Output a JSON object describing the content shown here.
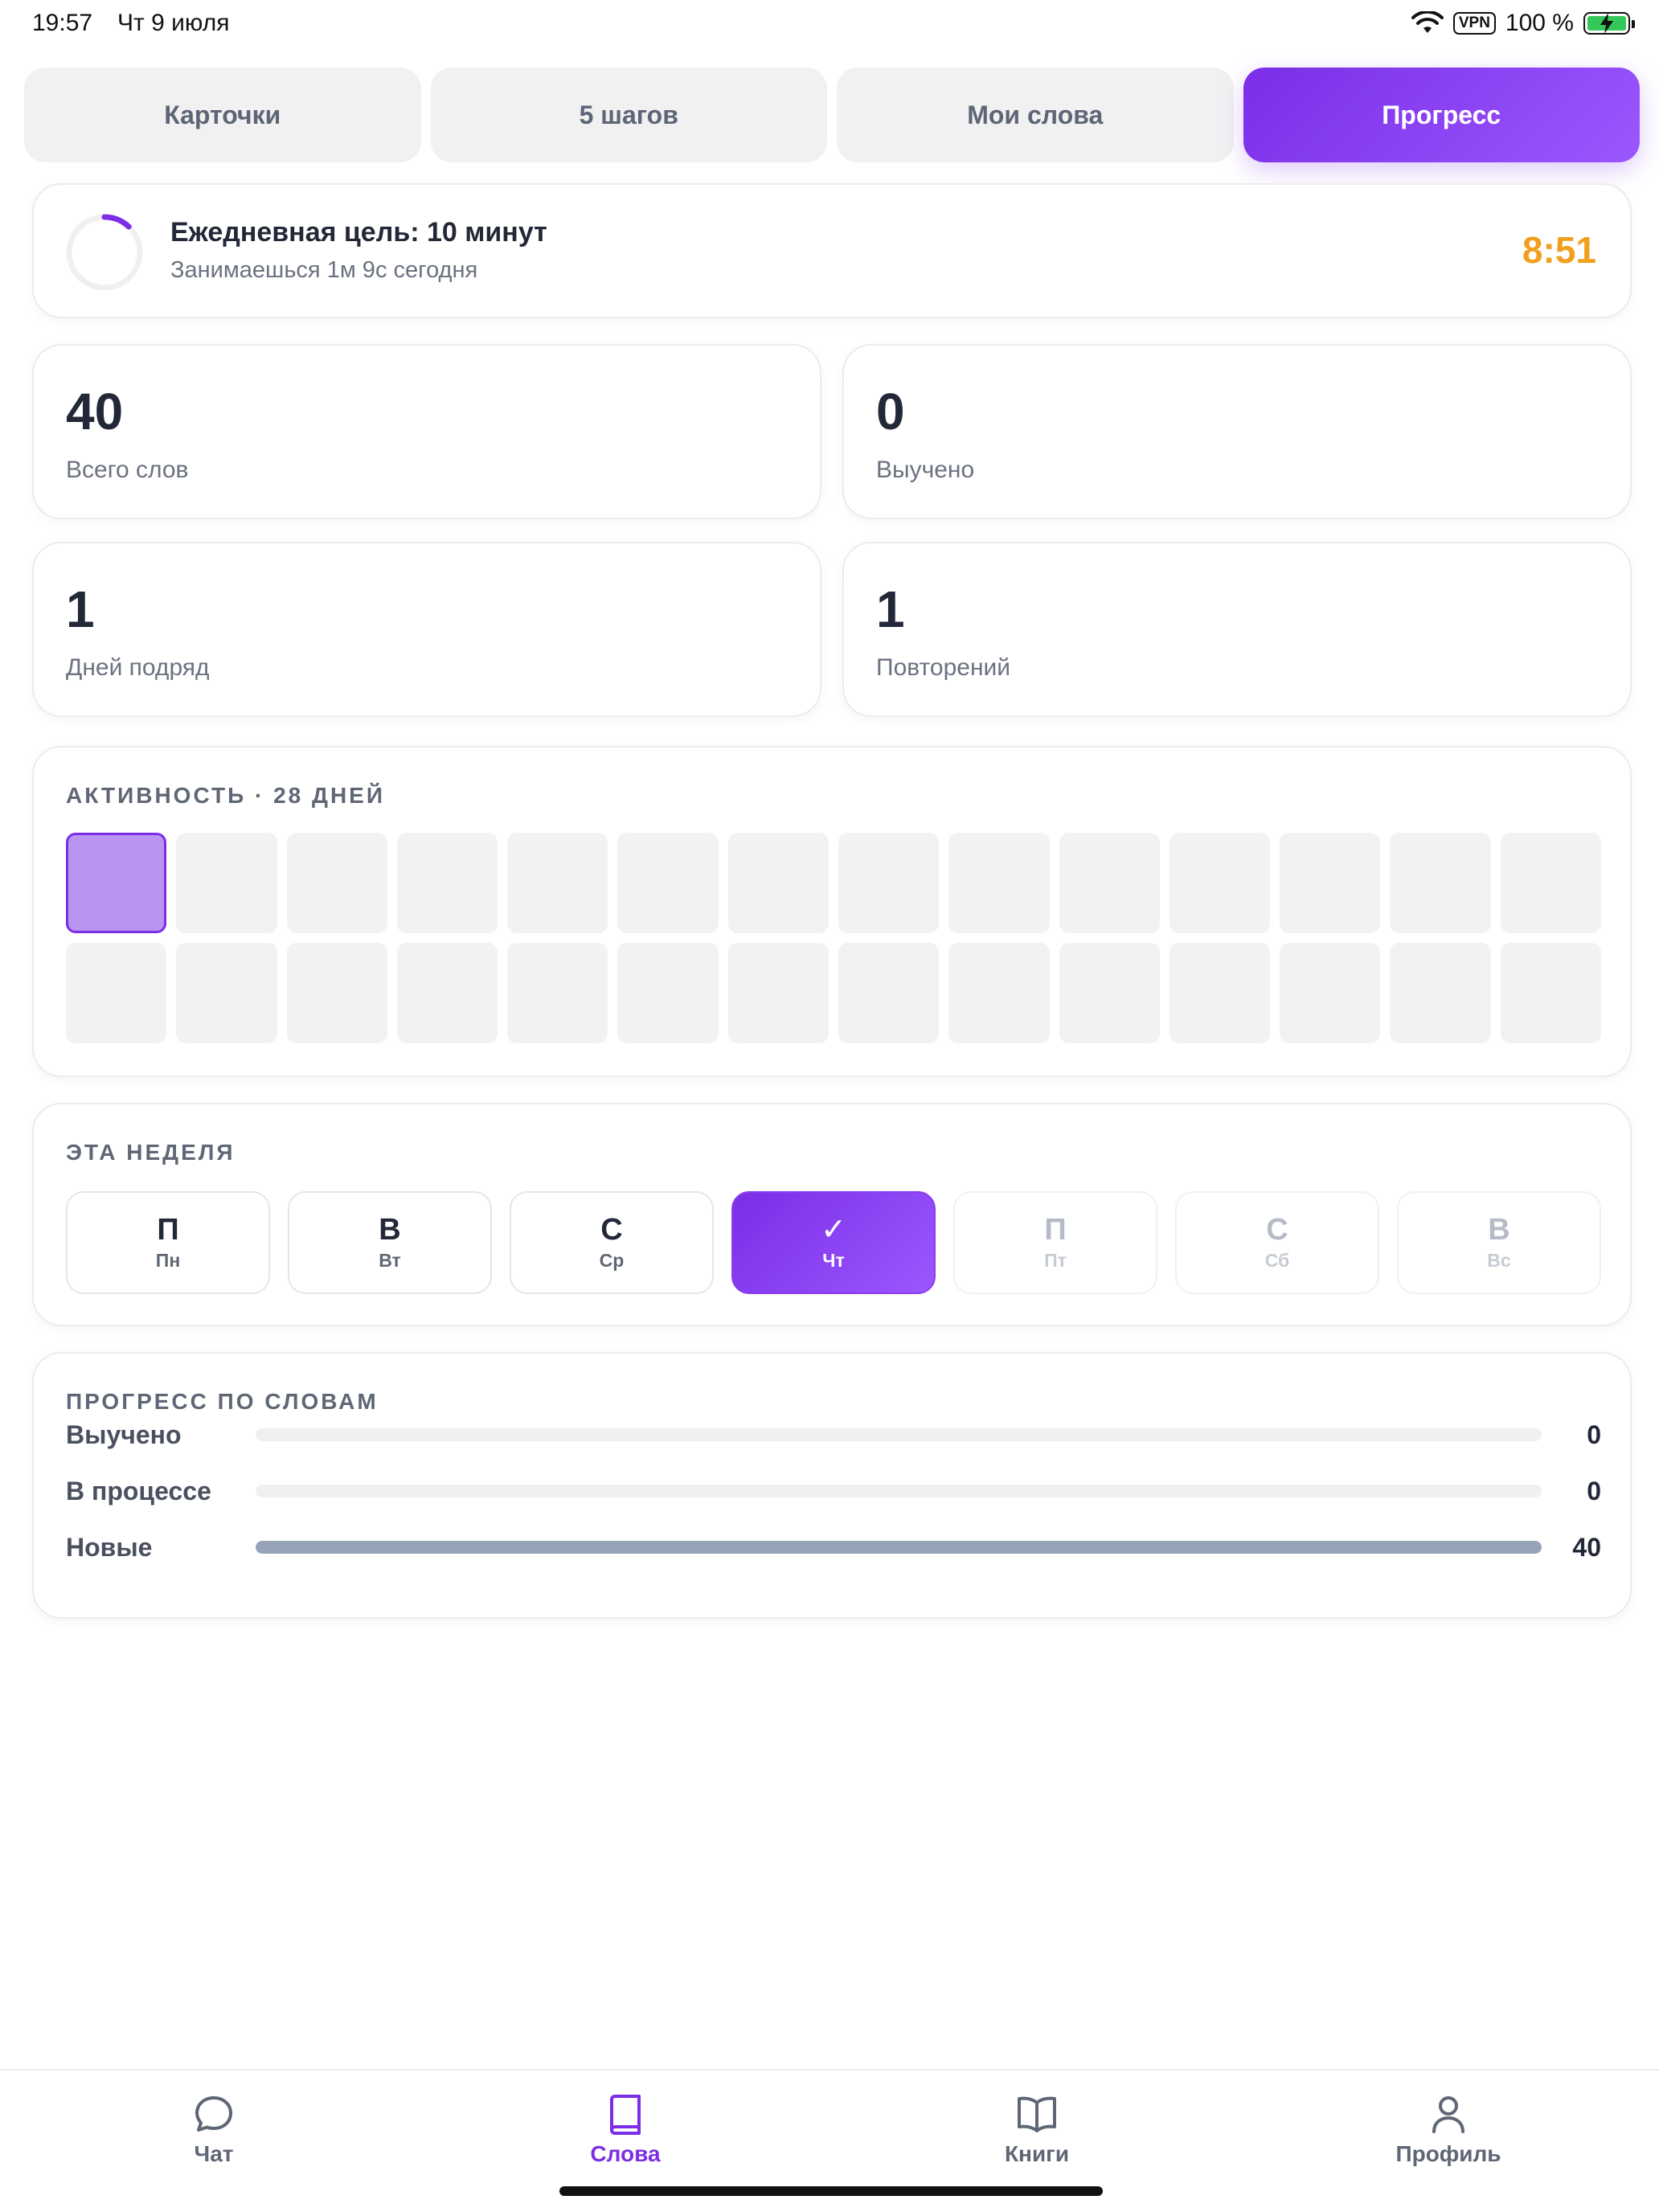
{
  "status_bar": {
    "time": "19:57",
    "date": "Чт 9 июля",
    "vpn": "VPN",
    "battery": "100 %"
  },
  "tabs": [
    {
      "label": "Карточки",
      "active": false
    },
    {
      "label": "5 шагов",
      "active": false
    },
    {
      "label": "Мои слова",
      "active": false
    },
    {
      "label": "Прогресс",
      "active": true
    }
  ],
  "goal": {
    "title": "Ежедневная цель: 10 минут",
    "subtitle": "Занимаешься 1м 9с сегодня",
    "remaining": "8:51",
    "progress_fraction": 0.12
  },
  "stats": [
    {
      "value": "40",
      "label": "Всего слов"
    },
    {
      "value": "0",
      "label": "Выучено"
    },
    {
      "value": "1",
      "label": "Дней подряд"
    },
    {
      "value": "1",
      "label": "Повторений"
    }
  ],
  "activity": {
    "title": "АКТИВНОСТЬ · 28 ДНЕЙ",
    "days": [
      1,
      0,
      0,
      0,
      0,
      0,
      0,
      0,
      0,
      0,
      0,
      0,
      0,
      0,
      0,
      0,
      0,
      0,
      0,
      0,
      0,
      0,
      0,
      0,
      0,
      0,
      0,
      0
    ]
  },
  "week": {
    "title": "ЭТА НЕДЕЛЯ",
    "days": [
      {
        "letter": "П",
        "short": "Пн",
        "state": "past"
      },
      {
        "letter": "В",
        "short": "Вт",
        "state": "past"
      },
      {
        "letter": "С",
        "short": "Ср",
        "state": "past"
      },
      {
        "letter": "✓",
        "short": "Чт",
        "state": "today"
      },
      {
        "letter": "П",
        "short": "Пт",
        "state": "future"
      },
      {
        "letter": "С",
        "short": "Сб",
        "state": "future"
      },
      {
        "letter": "В",
        "short": "Вс",
        "state": "future"
      }
    ]
  },
  "word_progress": {
    "title": "ПРОГРЕСС ПО СЛОВАМ",
    "rows": [
      {
        "label": "Выучено",
        "count": "0",
        "fraction": 0
      },
      {
        "label": "В процессе",
        "count": "0",
        "fraction": 0
      },
      {
        "label": "Новые",
        "count": "40",
        "fraction": 1
      }
    ]
  },
  "bottom_nav": [
    {
      "label": "Чат",
      "icon": "chat-bubble-icon",
      "active": false
    },
    {
      "label": "Слова",
      "icon": "book-icon",
      "active": true
    },
    {
      "label": "Книги",
      "icon": "open-book-icon",
      "active": false
    },
    {
      "label": "Профиль",
      "icon": "person-icon",
      "active": false
    }
  ],
  "colors": {
    "accent": "#7b2ee6",
    "timer": "#f0a01e",
    "new_words_bar": "#94a3b8"
  }
}
